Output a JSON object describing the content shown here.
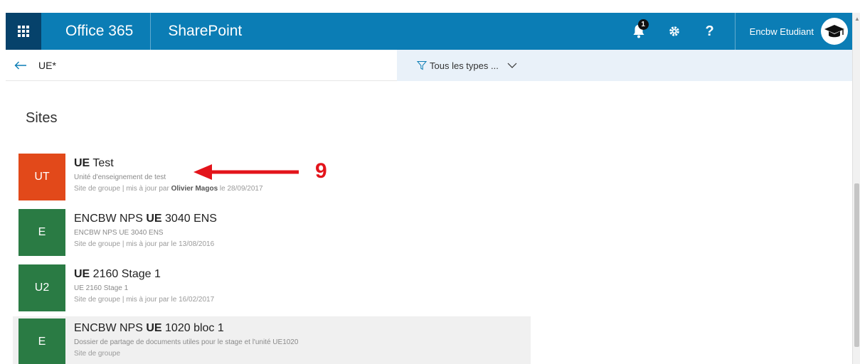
{
  "suitebar": {
    "brand": "Office 365",
    "app": "SharePoint",
    "notification_count": "1",
    "help_label": "?",
    "user_name": "Encbw Etudiant",
    "colors": {
      "bar": "#0b7db5",
      "waffle": "#06426b"
    }
  },
  "search": {
    "query": "UE*",
    "filter_label": "Tous les types ..."
  },
  "section": {
    "heading": "Sites"
  },
  "results": [
    {
      "initials": "UT",
      "color": "#e2491a",
      "title_bold": "UE",
      "title_rest": " Test",
      "title_pre": "",
      "description": "Unité d'enseignement de test",
      "info_prefix": "Site de groupe | mis à jour par ",
      "info_author": "Olivier Magos",
      "info_suffix": " le 28/09/2017"
    },
    {
      "initials": "E",
      "color": "#2a7b44",
      "title_pre": "ENCBW NPS ",
      "title_bold": "UE",
      "title_rest": " 3040 ENS",
      "description": "ENCBW NPS UE 3040 ENS",
      "info_prefix": "Site de groupe | mis à jour par le 13/08/2016",
      "info_author": "",
      "info_suffix": ""
    },
    {
      "initials": "U2",
      "color": "#2a7b44",
      "title_pre": "",
      "title_bold": "UE",
      "title_rest": " 2160 Stage 1",
      "description": "UE 2160 Stage 1",
      "info_prefix": "Site de groupe | mis à jour par le 16/02/2017",
      "info_author": "",
      "info_suffix": ""
    },
    {
      "initials": "E",
      "color": "#2a7b44",
      "title_pre": "ENCBW NPS ",
      "title_bold": "UE",
      "title_rest": " 1020 bloc 1",
      "description": "Dossier de partage de documents utiles pour le stage et l'unité UE1020",
      "info_prefix": "Site de groupe",
      "info_author": "",
      "info_suffix": ""
    }
  ],
  "annotation": {
    "number": "9",
    "color": "#e3141b"
  }
}
